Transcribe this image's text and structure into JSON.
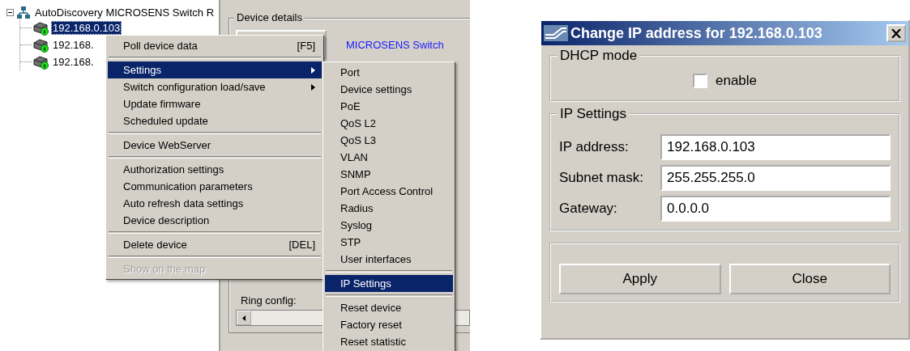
{
  "tree": {
    "root": {
      "label": "AutoDiscovery MICROSENS Switch R",
      "expanded": true,
      "children": [
        {
          "label": "192.168.0.103",
          "selected": true
        },
        {
          "label": "192.168.",
          "selected": false
        },
        {
          "label": "192.168.",
          "selected": false
        }
      ]
    }
  },
  "details_panel": {
    "group_title": "Device details",
    "device_type": "MICROSENS Switch",
    "ring_config_label": "Ring config:"
  },
  "context_menu": {
    "items": [
      {
        "kind": "item",
        "label": "Poll device data",
        "shortcut": "[F5]",
        "selected": false,
        "disabled": false,
        "submenu": false
      },
      {
        "kind": "separator"
      },
      {
        "kind": "item",
        "label": "Settings",
        "selected": true,
        "disabled": false,
        "submenu": true
      },
      {
        "kind": "item",
        "label": "Switch configuration load/save",
        "selected": false,
        "disabled": false,
        "submenu": true
      },
      {
        "kind": "item",
        "label": "Update firmware",
        "selected": false,
        "disabled": false,
        "submenu": false
      },
      {
        "kind": "item",
        "label": "Scheduled update",
        "selected": false,
        "disabled": false,
        "submenu": false
      },
      {
        "kind": "separator"
      },
      {
        "kind": "item",
        "label": "Device WebServer",
        "selected": false,
        "disabled": false,
        "submenu": false
      },
      {
        "kind": "separator"
      },
      {
        "kind": "item",
        "label": "Authorization settings",
        "selected": false,
        "disabled": false,
        "submenu": false
      },
      {
        "kind": "item",
        "label": "Communication parameters",
        "selected": false,
        "disabled": false,
        "submenu": false
      },
      {
        "kind": "item",
        "label": "Auto refresh data settings",
        "selected": false,
        "disabled": false,
        "submenu": false
      },
      {
        "kind": "item",
        "label": "Device description",
        "selected": false,
        "disabled": false,
        "submenu": false
      },
      {
        "kind": "separator"
      },
      {
        "kind": "item",
        "label": "Delete device",
        "shortcut": "[DEL]",
        "selected": false,
        "disabled": false,
        "submenu": false
      },
      {
        "kind": "separator"
      },
      {
        "kind": "item",
        "label": "Show on the map",
        "selected": false,
        "disabled": true,
        "submenu": false
      }
    ]
  },
  "submenu": {
    "items": [
      {
        "kind": "item",
        "label": "Port",
        "selected": false
      },
      {
        "kind": "item",
        "label": "Device settings",
        "selected": false
      },
      {
        "kind": "item",
        "label": "PoE",
        "selected": false
      },
      {
        "kind": "item",
        "label": "QoS L2",
        "selected": false
      },
      {
        "kind": "item",
        "label": "QoS L3",
        "selected": false
      },
      {
        "kind": "item",
        "label": "VLAN",
        "selected": false
      },
      {
        "kind": "item",
        "label": "SNMP",
        "selected": false
      },
      {
        "kind": "item",
        "label": "Port Access Control",
        "selected": false
      },
      {
        "kind": "item",
        "label": "Radius",
        "selected": false
      },
      {
        "kind": "item",
        "label": "Syslog",
        "selected": false
      },
      {
        "kind": "item",
        "label": "STP",
        "selected": false
      },
      {
        "kind": "item",
        "label": "User interfaces",
        "selected": false
      },
      {
        "kind": "separator"
      },
      {
        "kind": "item",
        "label": "IP Settings",
        "selected": true
      },
      {
        "kind": "separator"
      },
      {
        "kind": "item",
        "label": "Reset device",
        "selected": false
      },
      {
        "kind": "item",
        "label": "Factory reset",
        "selected": false
      },
      {
        "kind": "item",
        "label": "Reset statistic",
        "selected": false
      }
    ]
  },
  "dialog": {
    "title": "Change IP address for 192.168.0.103",
    "dhcp": {
      "title": "DHCP mode",
      "checkbox": {
        "label": "enable",
        "checked": false
      }
    },
    "ip_settings": {
      "title": "IP Settings",
      "fields": [
        {
          "label": "IP address:",
          "value": "192.168.0.103"
        },
        {
          "label": "Subnet mask:",
          "value": "255.255.255.0"
        },
        {
          "label": "Gateway:",
          "value": "0.0.0.0"
        }
      ]
    },
    "buttons": [
      "Apply",
      "Close"
    ]
  }
}
